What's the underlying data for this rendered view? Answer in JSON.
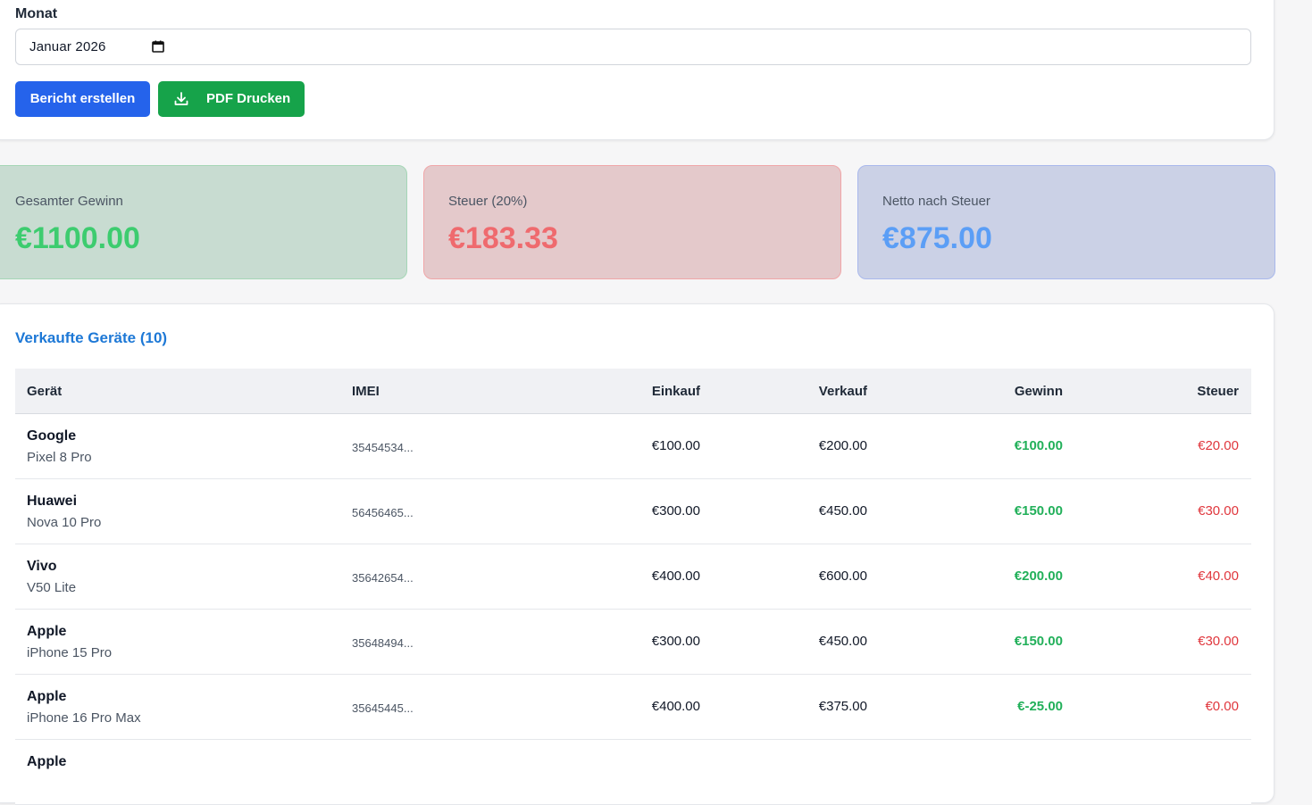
{
  "filter": {
    "month_label": "Monat",
    "month_value": "Januar  2026",
    "create_button": "Bericht erstellen",
    "pdf_button": "PDF Drucken"
  },
  "stats": {
    "total_profit_label": "Gesamter Gewinn",
    "total_profit_value": "€1100.00",
    "tax_label": "Steuer (20%)",
    "tax_value": "€183.33",
    "net_label": "Netto nach Steuer",
    "net_value": "€875.00"
  },
  "colors": {
    "green_value": "#3dcc6f",
    "red_value": "#ef6a6e",
    "blue_value": "#5b9ef6",
    "primary_button": "#2563eb",
    "success_button": "#16a34a",
    "title_blue": "#1d78d6"
  },
  "devices": {
    "title": "Verkaufte Geräte (10)",
    "columns": {
      "device": "Gerät",
      "imei": "IMEI",
      "purchase": "Einkauf",
      "sale": "Verkauf",
      "profit": "Gewinn",
      "tax": "Steuer"
    },
    "rows": [
      {
        "brand": "Google",
        "model": "Pixel 8 Pro",
        "imei": "35454534...",
        "purchase": "€100.00",
        "sale": "€200.00",
        "profit": "€100.00",
        "tax": "€20.00"
      },
      {
        "brand": "Huawei",
        "model": "Nova 10 Pro",
        "imei": "56456465...",
        "purchase": "€300.00",
        "sale": "€450.00",
        "profit": "€150.00",
        "tax": "€30.00"
      },
      {
        "brand": "Vivo",
        "model": "V50 Lite",
        "imei": "35642654...",
        "purchase": "€400.00",
        "sale": "€600.00",
        "profit": "€200.00",
        "tax": "€40.00"
      },
      {
        "brand": "Apple",
        "model": "iPhone 15 Pro",
        "imei": "35648494...",
        "purchase": "€300.00",
        "sale": "€450.00",
        "profit": "€150.00",
        "tax": "€30.00"
      },
      {
        "brand": "Apple",
        "model": "iPhone 16 Pro Max",
        "imei": "35645445...",
        "purchase": "€400.00",
        "sale": "€375.00",
        "profit": "€-25.00",
        "tax": "€0.00"
      },
      {
        "brand": "Apple",
        "model": "",
        "imei": "",
        "purchase": "",
        "sale": "",
        "profit": "",
        "tax": ""
      }
    ]
  }
}
